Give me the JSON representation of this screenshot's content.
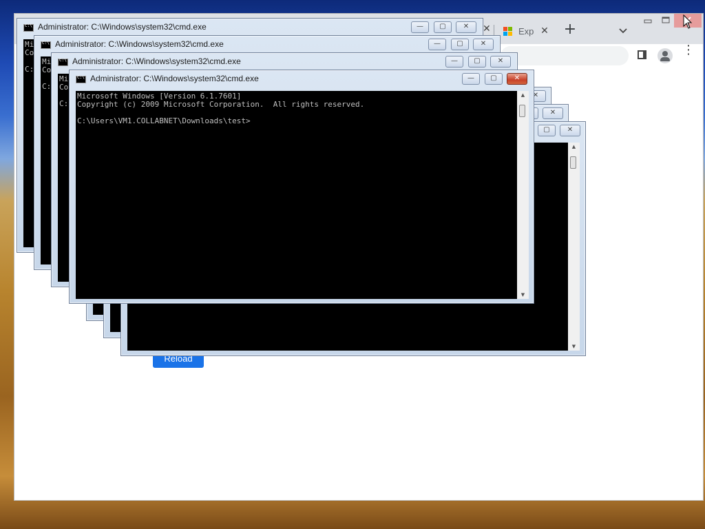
{
  "browser": {
    "tab_title": "Exp",
    "reload_label": "Reload"
  },
  "cmd": {
    "title": "Administrator: C:\\Windows\\system32\\cmd.exe",
    "line1": "Microsoft Windows [Version 6.1.7601]",
    "line2": "Copyright (c) 2009 Microsoft Corporation.  All rights reserved.",
    "prompt": "C:\\Users\\VM1.COLLABNET\\Downloads\\test>",
    "peek1": "Mi\nCo\n\nC:",
    "peek2": "Mi\nCo\n\nC:",
    "peek3": "Mi\nCo\n\nC:"
  },
  "icons": {
    "window_minimize": "—",
    "window_maximize": "▢",
    "window_close": "✕",
    "new_tab": "+",
    "tab_search": "chevron-down",
    "menu": "⋮"
  },
  "colors": {
    "console_bg": "#000000",
    "console_text": "#c0c0c0",
    "reload_button": "#1a73e8",
    "close_active": "#c7412a"
  }
}
